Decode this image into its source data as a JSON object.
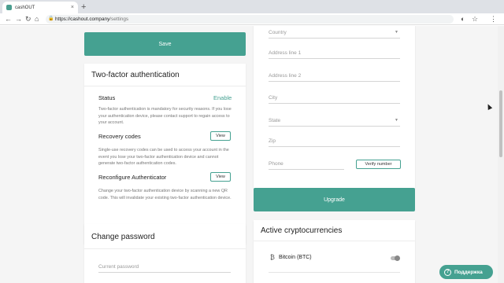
{
  "browser": {
    "tab_title": "cashOUT",
    "tab_close": "×",
    "new_tab": "+",
    "back": "←",
    "forward": "→",
    "reload": "↻",
    "home": "⌂",
    "lock": "🔒",
    "url_host": "https://cashout.company",
    "url_path": "/settings",
    "account_icon": "◐",
    "star_icon": "☆",
    "menu_icon": "⋮"
  },
  "left_column": {
    "save_label": "Save",
    "two_factor": {
      "title": "Two-factor authentication",
      "status_label": "Status",
      "status_action": "Enable",
      "status_desc": "Two-factor authentication is mandatory for security reasons. If you lose your authentication device, please contact support to regain access to your account.",
      "recovery_label": "Recovery codes",
      "recovery_button": "View",
      "recovery_desc": "Single-use recovery codes can be used to access your account in the event you lose your two-factor authentication device and cannot generate two-factor authentication codes.",
      "reconfigure_label": "Reconfigure Authenticator",
      "reconfigure_button": "View",
      "reconfigure_desc": "Change your two-factor authentication device by scanning a new QR code. This will invalidate your existing two-factor authentication device."
    },
    "change_password": {
      "title": "Change password",
      "current_placeholder": "Current password"
    }
  },
  "right_column": {
    "country_placeholder": "Country",
    "address1_placeholder": "Address line 1",
    "address2_placeholder": "Address line 2",
    "city_placeholder": "City",
    "state_placeholder": "State",
    "zip_placeholder": "Zip",
    "phone_placeholder": "Phone",
    "verify_button": "Verify number",
    "upgrade_label": "Upgrade",
    "crypto": {
      "title": "Active cryptocurrencies",
      "items": [
        {
          "icon": "₿",
          "label": "Bitcoin (BTC)",
          "enabled": false
        }
      ]
    }
  },
  "support": {
    "icon": "?",
    "label": "Поддержка"
  },
  "colors": {
    "accent": "#45a191"
  }
}
